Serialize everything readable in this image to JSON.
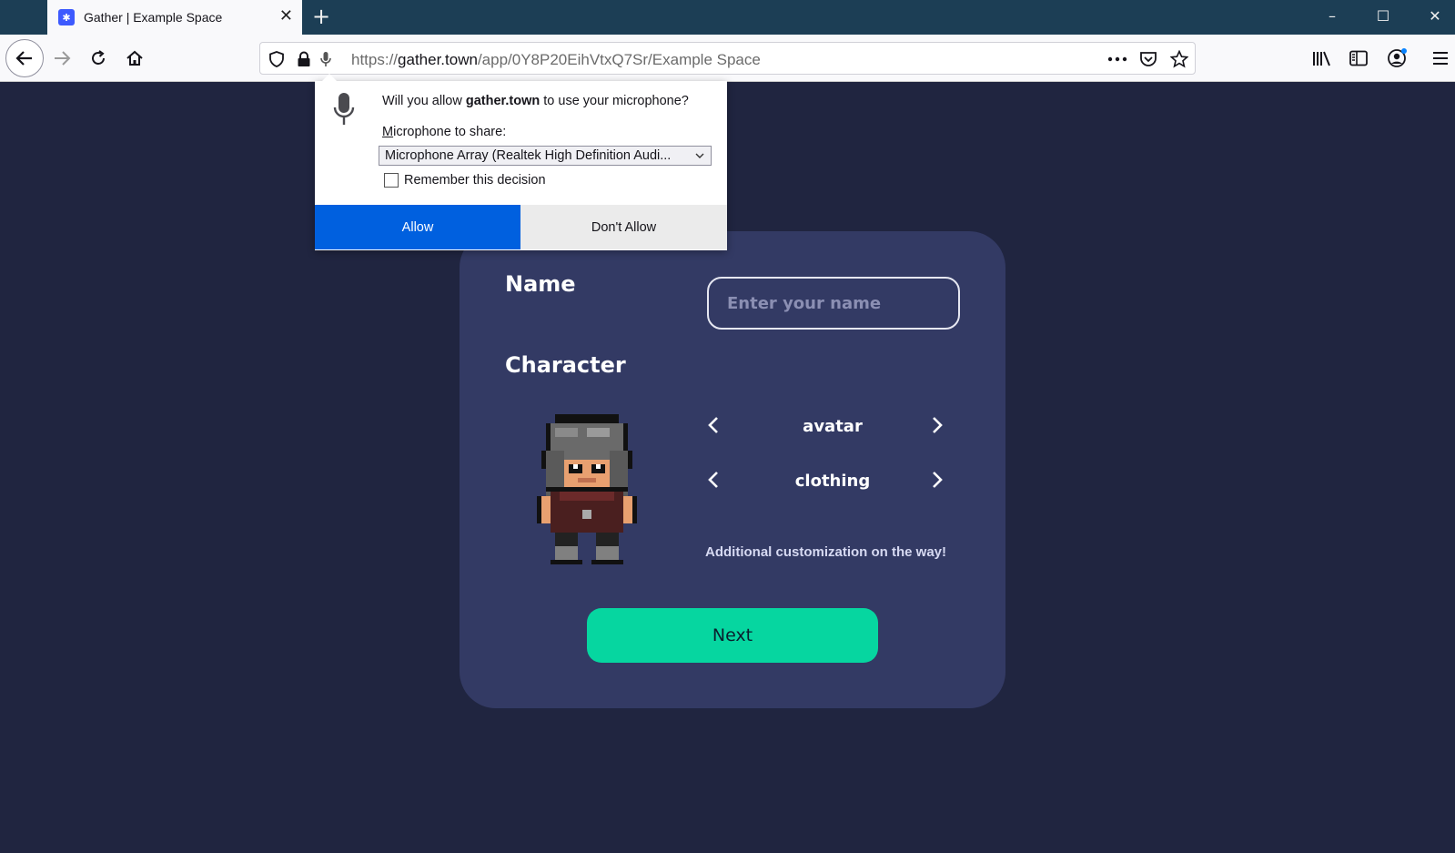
{
  "browser": {
    "tab": {
      "title": "Gather | Example Space",
      "favicon": "gather-logo-icon"
    },
    "url": {
      "prefix": "https://",
      "host": "gather.town",
      "path": "/app/0Y8P20EihVtxQ7Sr/Example Space"
    }
  },
  "permission_popup": {
    "question_prefix": "Will you allow ",
    "question_host": "gather.town",
    "question_suffix": " to use your microphone?",
    "share_label": "Microphone to share:",
    "selected_device": "Microphone Array (Realtek High Definition Audi...",
    "remember_label": "Remember this decision",
    "remember_checked": false,
    "allow_label": "Allow",
    "deny_label": "Don't Allow",
    "allow_color": "#0060df"
  },
  "card": {
    "name_label": "Name",
    "name_placeholder": "Enter your name",
    "character_label": "Character",
    "options": [
      {
        "label": "avatar"
      },
      {
        "label": "clothing"
      }
    ],
    "hint": "Additional customization on the way!",
    "next_label": "Next",
    "accent_color": "#06d6a0",
    "card_color": "#333a64",
    "page_bg": "#202540"
  }
}
